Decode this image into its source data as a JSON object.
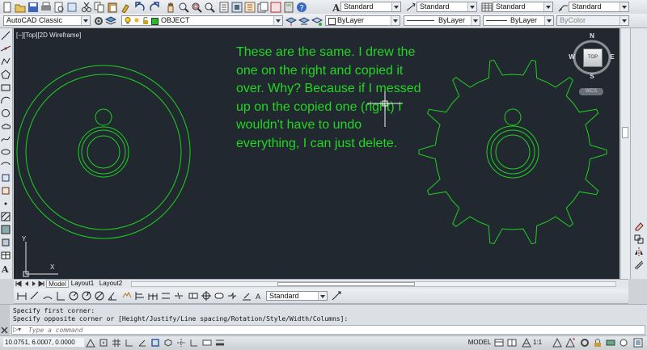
{
  "toolbar_row1": {
    "text_style": "Standard",
    "dim_style": "Standard",
    "table_style": "Standard",
    "mleader_style": "Standard"
  },
  "toolbar_row2": {
    "workspace": "AutoCAD Classic",
    "layer": "OBJECT",
    "color": "ByLayer",
    "linetype": "ByLayer",
    "lineweight": "ByLayer",
    "plotstyle": "ByColor"
  },
  "viewport": {
    "label": "[−][Top][2D Wireframe]",
    "annotation": "These are the same. I drew the one on the right and copied it over. Why? Because if I messed up on the copied one (right) I wouldn't have to undo everything, I can just delete.",
    "annotation_color": "#22d622"
  },
  "viewcube": {
    "north": "N",
    "south": "S",
    "east": "E",
    "west": "W",
    "face": "TOP",
    "wcs": "WCS"
  },
  "ucs": {
    "y_label": "Y",
    "x_label": "X"
  },
  "tabs": [
    "Model",
    "Layout1",
    "Layout2"
  ],
  "bottom_toolbar": {
    "style": "Standard"
  },
  "command": {
    "history": [
      "Specify first corner:",
      "Specify opposite corner or [Height/Justify/Line spacing/Rotation/Style/Width/Columns]:"
    ],
    "prompt_placeholder": "Type a command"
  },
  "status": {
    "coordinates": "10.0751, 6.0007, 0.0000",
    "space": "MODEL",
    "scale": "1:1"
  }
}
